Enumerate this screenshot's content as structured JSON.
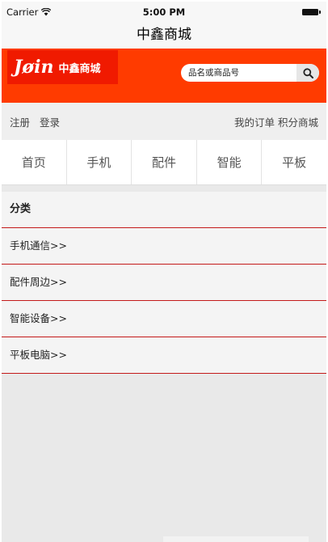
{
  "status_bar": {
    "carrier": "Carrier",
    "time": "5:00 PM"
  },
  "nav": {
    "title": "中鑫商城"
  },
  "header": {
    "logo_mark": "Jøin",
    "logo_name": "中鑫商城",
    "search": {
      "placeholder": "品名或商品号",
      "icon": "search-icon"
    },
    "colors": {
      "header_bg": "#ff3b00",
      "logo_bg": "#f01a00",
      "divider_red": "#c41a1a"
    }
  },
  "account": {
    "register": "注册",
    "login": "登录",
    "my_orders": "我的订单",
    "points_mall": "积分商城"
  },
  "tabs": [
    {
      "label": "首页"
    },
    {
      "label": "手机"
    },
    {
      "label": "配件"
    },
    {
      "label": "智能"
    },
    {
      "label": "平板"
    }
  ],
  "categories": {
    "heading": "分类",
    "items": [
      {
        "label": "手机通信>>"
      },
      {
        "label": "配件周边>>"
      },
      {
        "label": "智能设备>>"
      },
      {
        "label": "平板电脑>>"
      }
    ]
  }
}
